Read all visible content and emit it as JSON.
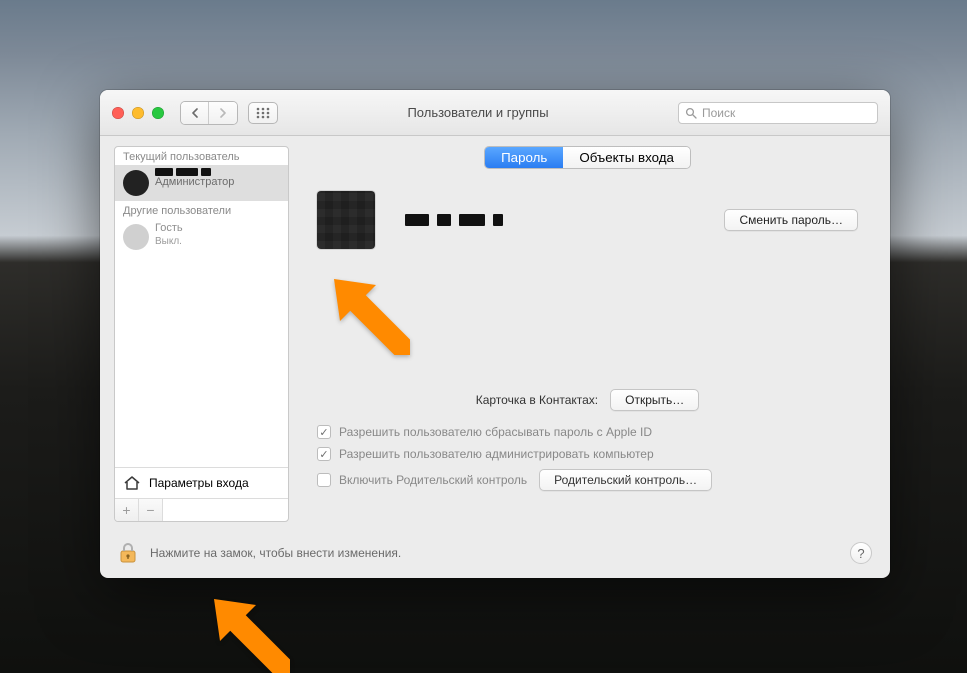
{
  "window": {
    "title": "Пользователи и группы",
    "search_placeholder": "Поиск"
  },
  "sidebar": {
    "current_header": "Текущий пользователь",
    "current_role": "Администратор",
    "others_header": "Другие пользователи",
    "guest_name": "Гость",
    "guest_status": "Выкл.",
    "login_options": "Параметры входа"
  },
  "tabs": {
    "password": "Пароль",
    "login_items": "Объекты входа"
  },
  "main": {
    "change_password": "Сменить пароль…",
    "contacts_label": "Карточка в Контактах:",
    "open": "Открыть…",
    "allow_reset_apple_id": "Разрешить пользователю сбрасывать пароль с Apple ID",
    "allow_admin": "Разрешить пользователю администрировать компьютер",
    "enable_parental": "Включить Родительский контроль",
    "parental_button": "Родительский контроль…"
  },
  "lock": {
    "text": "Нажмите на замок, чтобы внести изменения."
  }
}
